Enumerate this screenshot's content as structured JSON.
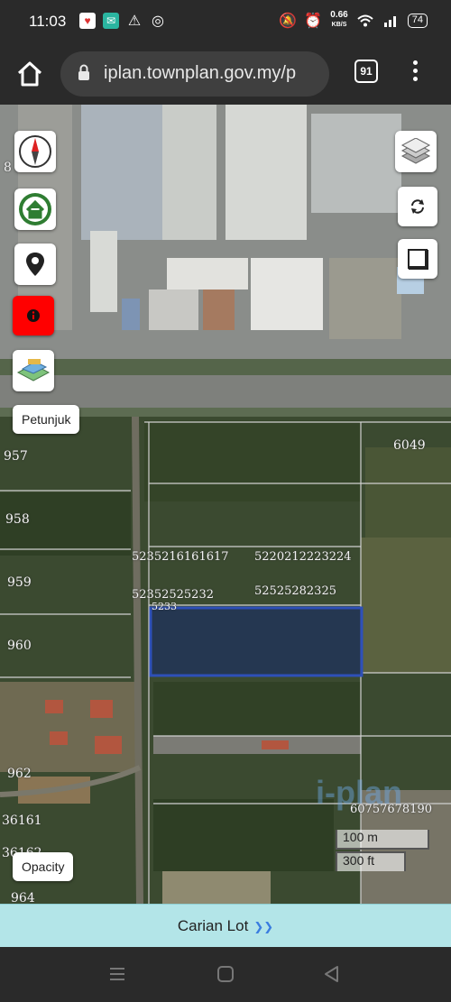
{
  "status": {
    "time": "11:03",
    "speed_value": "0.66",
    "speed_unit": "KB/S",
    "battery": "74"
  },
  "browser": {
    "url": "iplan.townplan.gov.my/p",
    "tab_count": "91"
  },
  "map": {
    "controls": {
      "petunjuk_label": "Petunjuk",
      "opacity_label": "Opacity"
    },
    "lot_labels": [
      "8",
      "957",
      "958",
      "959",
      "960",
      "962",
      "36161",
      "36162",
      "964",
      "6049",
      "5235216161617",
      "5220212223224",
      "52352525232",
      "52525282325",
      "5233",
      "60757678190"
    ],
    "watermark": "i-plan",
    "scale": {
      "metric": "100 m",
      "imperial": "300 ft"
    },
    "highlight_color": "#2e50b8"
  },
  "search": {
    "label": "Carian Lot"
  }
}
